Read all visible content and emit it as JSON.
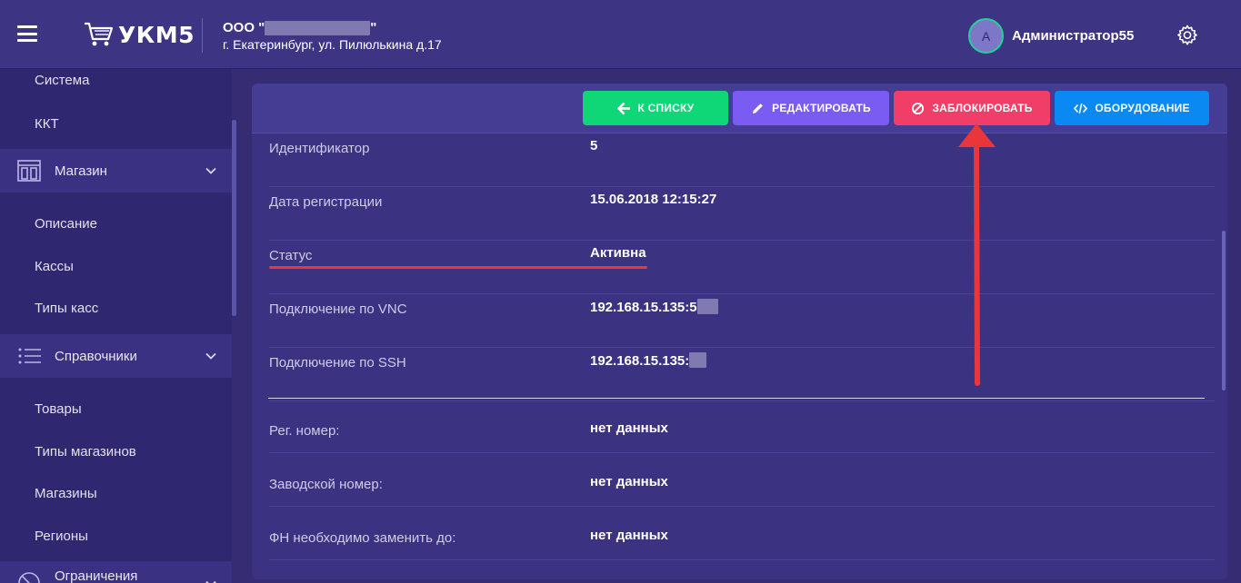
{
  "header": {
    "logo_text": "УКМ5",
    "org_name_prefix": "ООО \"",
    "org_name_suffix": "\"",
    "org_address": "г. Екатеринбург, ул. Пилюлькина д.17",
    "avatar_letter": "А",
    "username": "Администратор55"
  },
  "sidebar": {
    "items": [
      {
        "label": "Система",
        "type": "sub"
      },
      {
        "label": "ККТ",
        "type": "sub"
      },
      {
        "label": "Магазин",
        "type": "section",
        "icon": "store-icon"
      },
      {
        "label": "Описание",
        "type": "sub"
      },
      {
        "label": "Кассы",
        "type": "sub"
      },
      {
        "label": "Типы касс",
        "type": "sub"
      },
      {
        "label": "Справочники",
        "type": "section",
        "icon": "list-icon"
      },
      {
        "label": "Товары",
        "type": "sub"
      },
      {
        "label": "Типы магазинов",
        "type": "sub"
      },
      {
        "label": "Магазины",
        "type": "sub"
      },
      {
        "label": "Регионы",
        "type": "sub"
      },
      {
        "label": "Ограничения",
        "type": "section",
        "icon": "restriction-icon"
      }
    ]
  },
  "toolbar": {
    "back_label": "К СПИСКУ",
    "edit_label": "РЕДАКТИРОВАТЬ",
    "block_label": "ЗАБЛОКИРОВАТЬ",
    "equipment_label": "ОБОРУДОВАНИЕ"
  },
  "details": [
    {
      "key": "Идентификатор",
      "value": "5"
    },
    {
      "key": "Дата регистрации",
      "value": "15.06.2018 12:15:27"
    },
    {
      "key": "Статус",
      "value": "Активна"
    },
    {
      "key": "Подключение по VNC",
      "value": "192.168.15.135:5"
    },
    {
      "key": "Подключение по SSH",
      "value": "192.168.15.135:"
    }
  ],
  "fiscal": [
    {
      "key": "Рег. номер:",
      "value": "нет данных"
    },
    {
      "key": "Заводской номер:",
      "value": "нет данных"
    },
    {
      "key": "ФН необходимо заменить до:",
      "value": "нет данных"
    }
  ],
  "colors": {
    "back": "#0fd677",
    "edit": "#7b5cf2",
    "block": "#f03e68",
    "equipment": "#0a89f2",
    "annotation": "#e8363b"
  }
}
